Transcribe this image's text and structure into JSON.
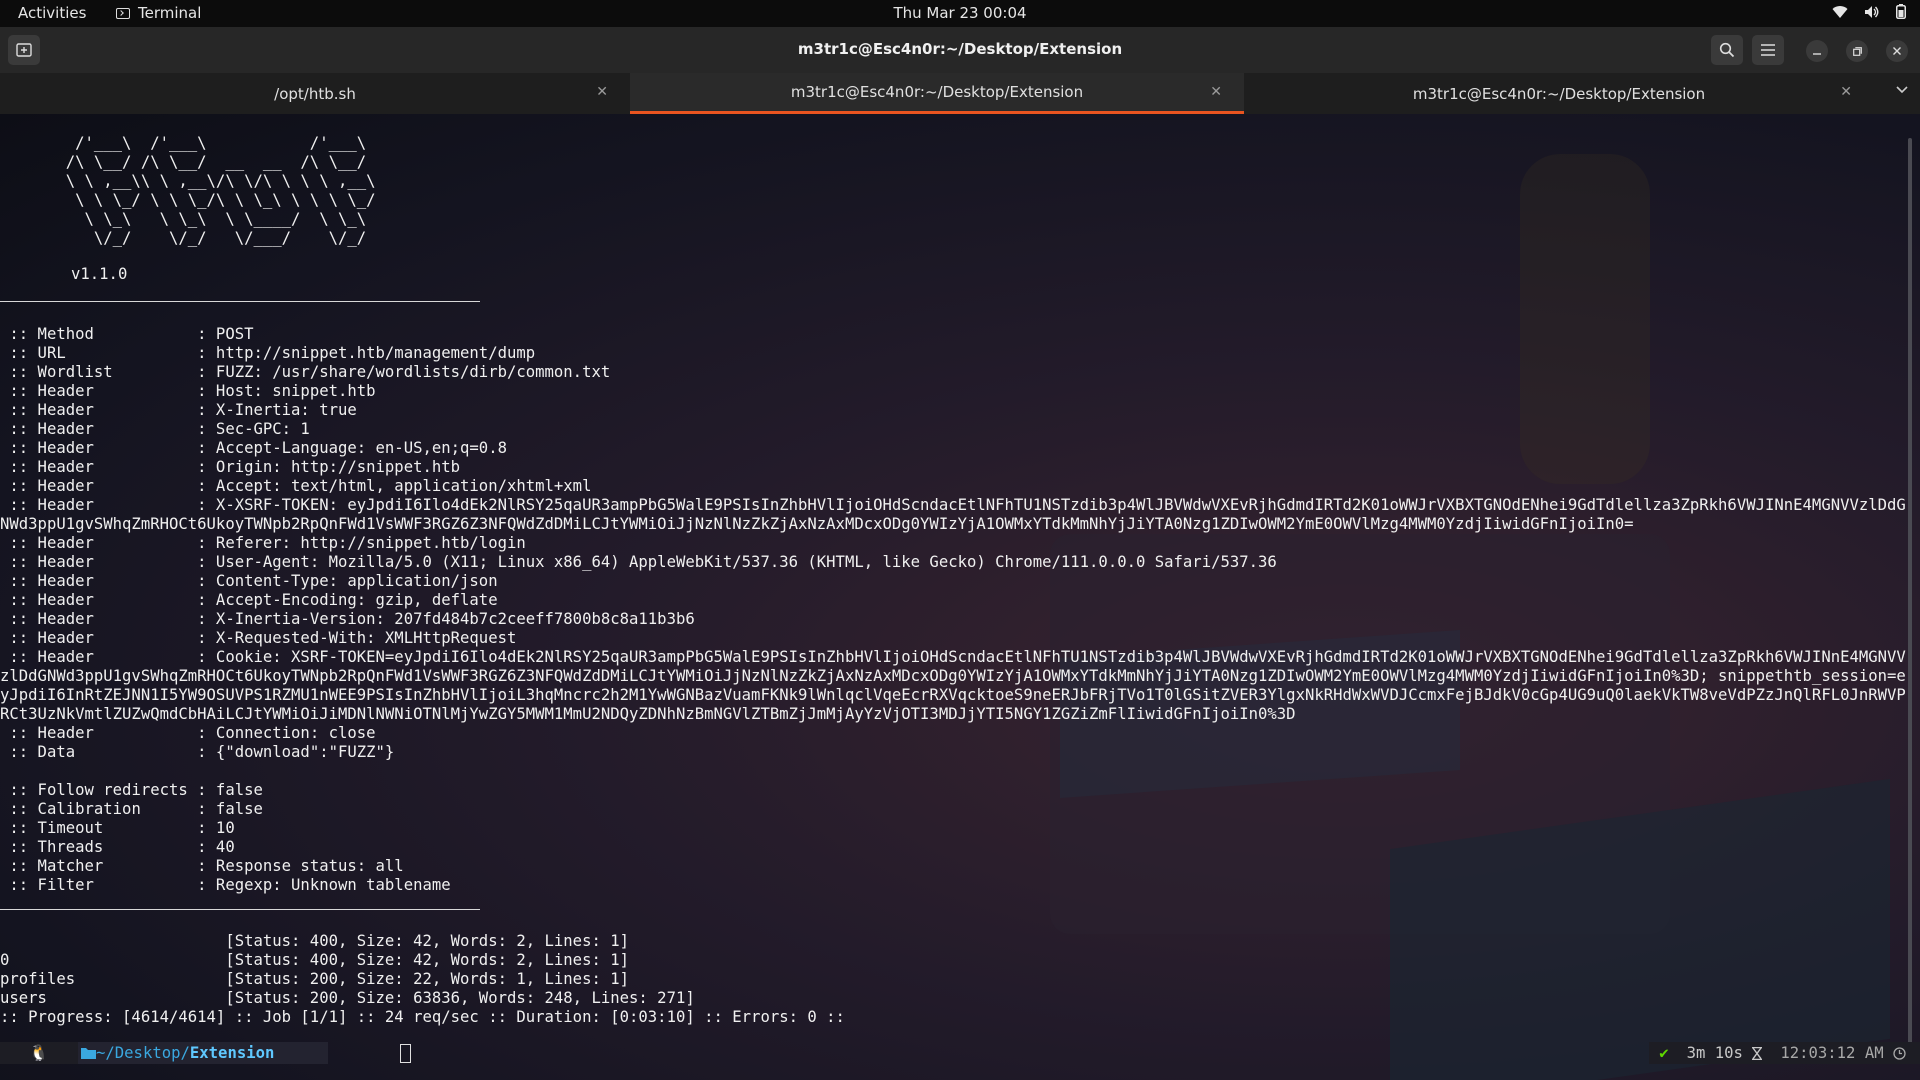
{
  "topbar": {
    "activities": "Activities",
    "app_name": "Terminal",
    "clock": "Thu Mar 23  00:04"
  },
  "window": {
    "title": "m3tr1c@Esc4n0r:~/Desktop/Extension"
  },
  "tabs": [
    {
      "label": "/opt/htb.sh",
      "active": false
    },
    {
      "label": "m3tr1c@Esc4n0r:~/Desktop/Extension",
      "active": true
    },
    {
      "label": "m3tr1c@Esc4n0r:~/Desktop/Extension",
      "active": false
    }
  ],
  "terminal": {
    "banner": "        /'___\\  /'___\\           /'___\\       \n       /\\ \\__/ /\\ \\__/  __  __  /\\ \\__/       \n       \\ \\ ,__\\\\ \\ ,__\\/\\ \\/\\ \\ \\ \\ ,__\\      \n        \\ \\ \\_/ \\ \\ \\_/\\ \\ \\_\\ \\ \\ \\ \\_/      \n         \\ \\_\\   \\ \\_\\  \\ \\____/  \\ \\_\\       \n          \\/_/    \\/_/   \\/___/    \\/_/       ",
    "version": "v1.1.0",
    "config": " :: Method           : POST\n :: URL              : http://snippet.htb/management/dump\n :: Wordlist         : FUZZ: /usr/share/wordlists/dirb/common.txt\n :: Header           : Host: snippet.htb\n :: Header           : X-Inertia: true\n :: Header           : Sec-GPC: 1\n :: Header           : Accept-Language: en-US,en;q=0.8\n :: Header           : Origin: http://snippet.htb\n :: Header           : Accept: text/html, application/xhtml+xml\n :: Header           : X-XSRF-TOKEN: eyJpdiI6Ilo4dEk2NlRSY25qaUR3ampPbG5WalE9PSIsInZhbHVlIjoiOHdScndacEtlNFhTU1NSTzdib3p4WlJBVWdwVXEvRjhGdmdIRTd2K01oWWJrVXBXTGNOdENhei9GdTdlellza3ZpRkh6VWJINnE4MGNVVzlDdGNWd3ppU1gvSWhqZmRHOCt6UkoyTWNpb2RpQnFWd1VsWWF3RGZ6Z3NFQWdZdDMiLCJtYWMiOiJjNzNlNzZkZjAxNzAxMDcxODg0YWIzYjA1OWMxYTdkMmNhYjJiYTA0Nzg1ZDIwOWM2YmE0OWVlMzg4MWM0YzdjIiwidGFnIjoiIn0=\n :: Header           : Referer: http://snippet.htb/login\n :: Header           : User-Agent: Mozilla/5.0 (X11; Linux x86_64) AppleWebKit/537.36 (KHTML, like Gecko) Chrome/111.0.0.0 Safari/537.36\n :: Header           : Content-Type: application/json\n :: Header           : Accept-Encoding: gzip, deflate\n :: Header           : X-Inertia-Version: 207fd484b7c2ceeff7800b8c8a11b3b6\n :: Header           : X-Requested-With: XMLHttpRequest\n :: Header           : Cookie: XSRF-TOKEN=eyJpdiI6Ilo4dEk2NlRSY25qaUR3ampPbG5WalE9PSIsInZhbHVlIjoiOHdScndacEtlNFhTU1NSTzdib3p4WlJBVWdwVXEvRjhGdmdIRTd2K01oWWJrVXBXTGNOdENhei9GdTdlellza3ZpRkh6VWJINnE4MGNVVzlDdGNWd3ppU1gvSWhqZmRHOCt6UkoyTWNpb2RpQnFWd1VsWWF3RGZ6Z3NFQWdZdDMiLCJtYWMiOiJjNzNlNzZkZjAxNzAxMDcxODg0YWIzYjA1OWMxYTdkMmNhYjJiYTA0Nzg1ZDIwOWM2YmE0OWVlMzg4MWM0YzdjIiwidGFnIjoiIn0%3D; snippethtb_session=eyJpdiI6InRtZEJNN1I5YW9OSUVPS1RZMU1nWEE9PSIsInZhbHVlIjoiL3hqMncrc2h2M1YwWGNBazVuamFKNk9lWnlqclVqeEcrRXVqcktoeS9neERJbFRjTVo1T0lGSitZVER3YlgxNkRHdWxWVDJCcmxFejBJdkV0cGp4UG9uQ0laekVkTW8veVdPZzJnQlRFL0JnRWVPRCt3UzNkVmtlZUZwQmdCbHAiLCJtYWMiOiJiMDNlNWNiOTNlMjYwZGY5MWM1MmU2NDQyZDNhNzBmNGVlZTBmZjJmMjAyYzVjOTI3MDJjYTI5NGY1ZGZiZmFlIiwidGFnIjoiIn0%3D\n :: Header           : Connection: close\n :: Data             : {\"download\":\"FUZZ\"}\n\n :: Follow redirects : false\n :: Calibration      : false\n :: Timeout          : 10\n :: Threads          : 40\n :: Matcher          : Response status: all\n :: Filter           : Regexp: Unknown tablename",
    "results": "                        [Status: 400, Size: 42, Words: 2, Lines: 1]\n0                       [Status: 400, Size: 42, Words: 2, Lines: 1]\nprofiles                [Status: 200, Size: 22, Words: 1, Lines: 1]\nusers                   [Status: 200, Size: 63836, Words: 248, Lines: 271]\n:: Progress: [4614/4614] :: Job [1/1] :: 24 req/sec :: Duration: [0:03:10] :: Errors: 0 ::",
    "prompt": {
      "os_glyph": "🐧",
      "path_prefix": "~/Desktop/",
      "path_current": "Extension",
      "status_ok": "✔",
      "duration": "3m 10s",
      "time": "12:03:12 AM"
    }
  }
}
